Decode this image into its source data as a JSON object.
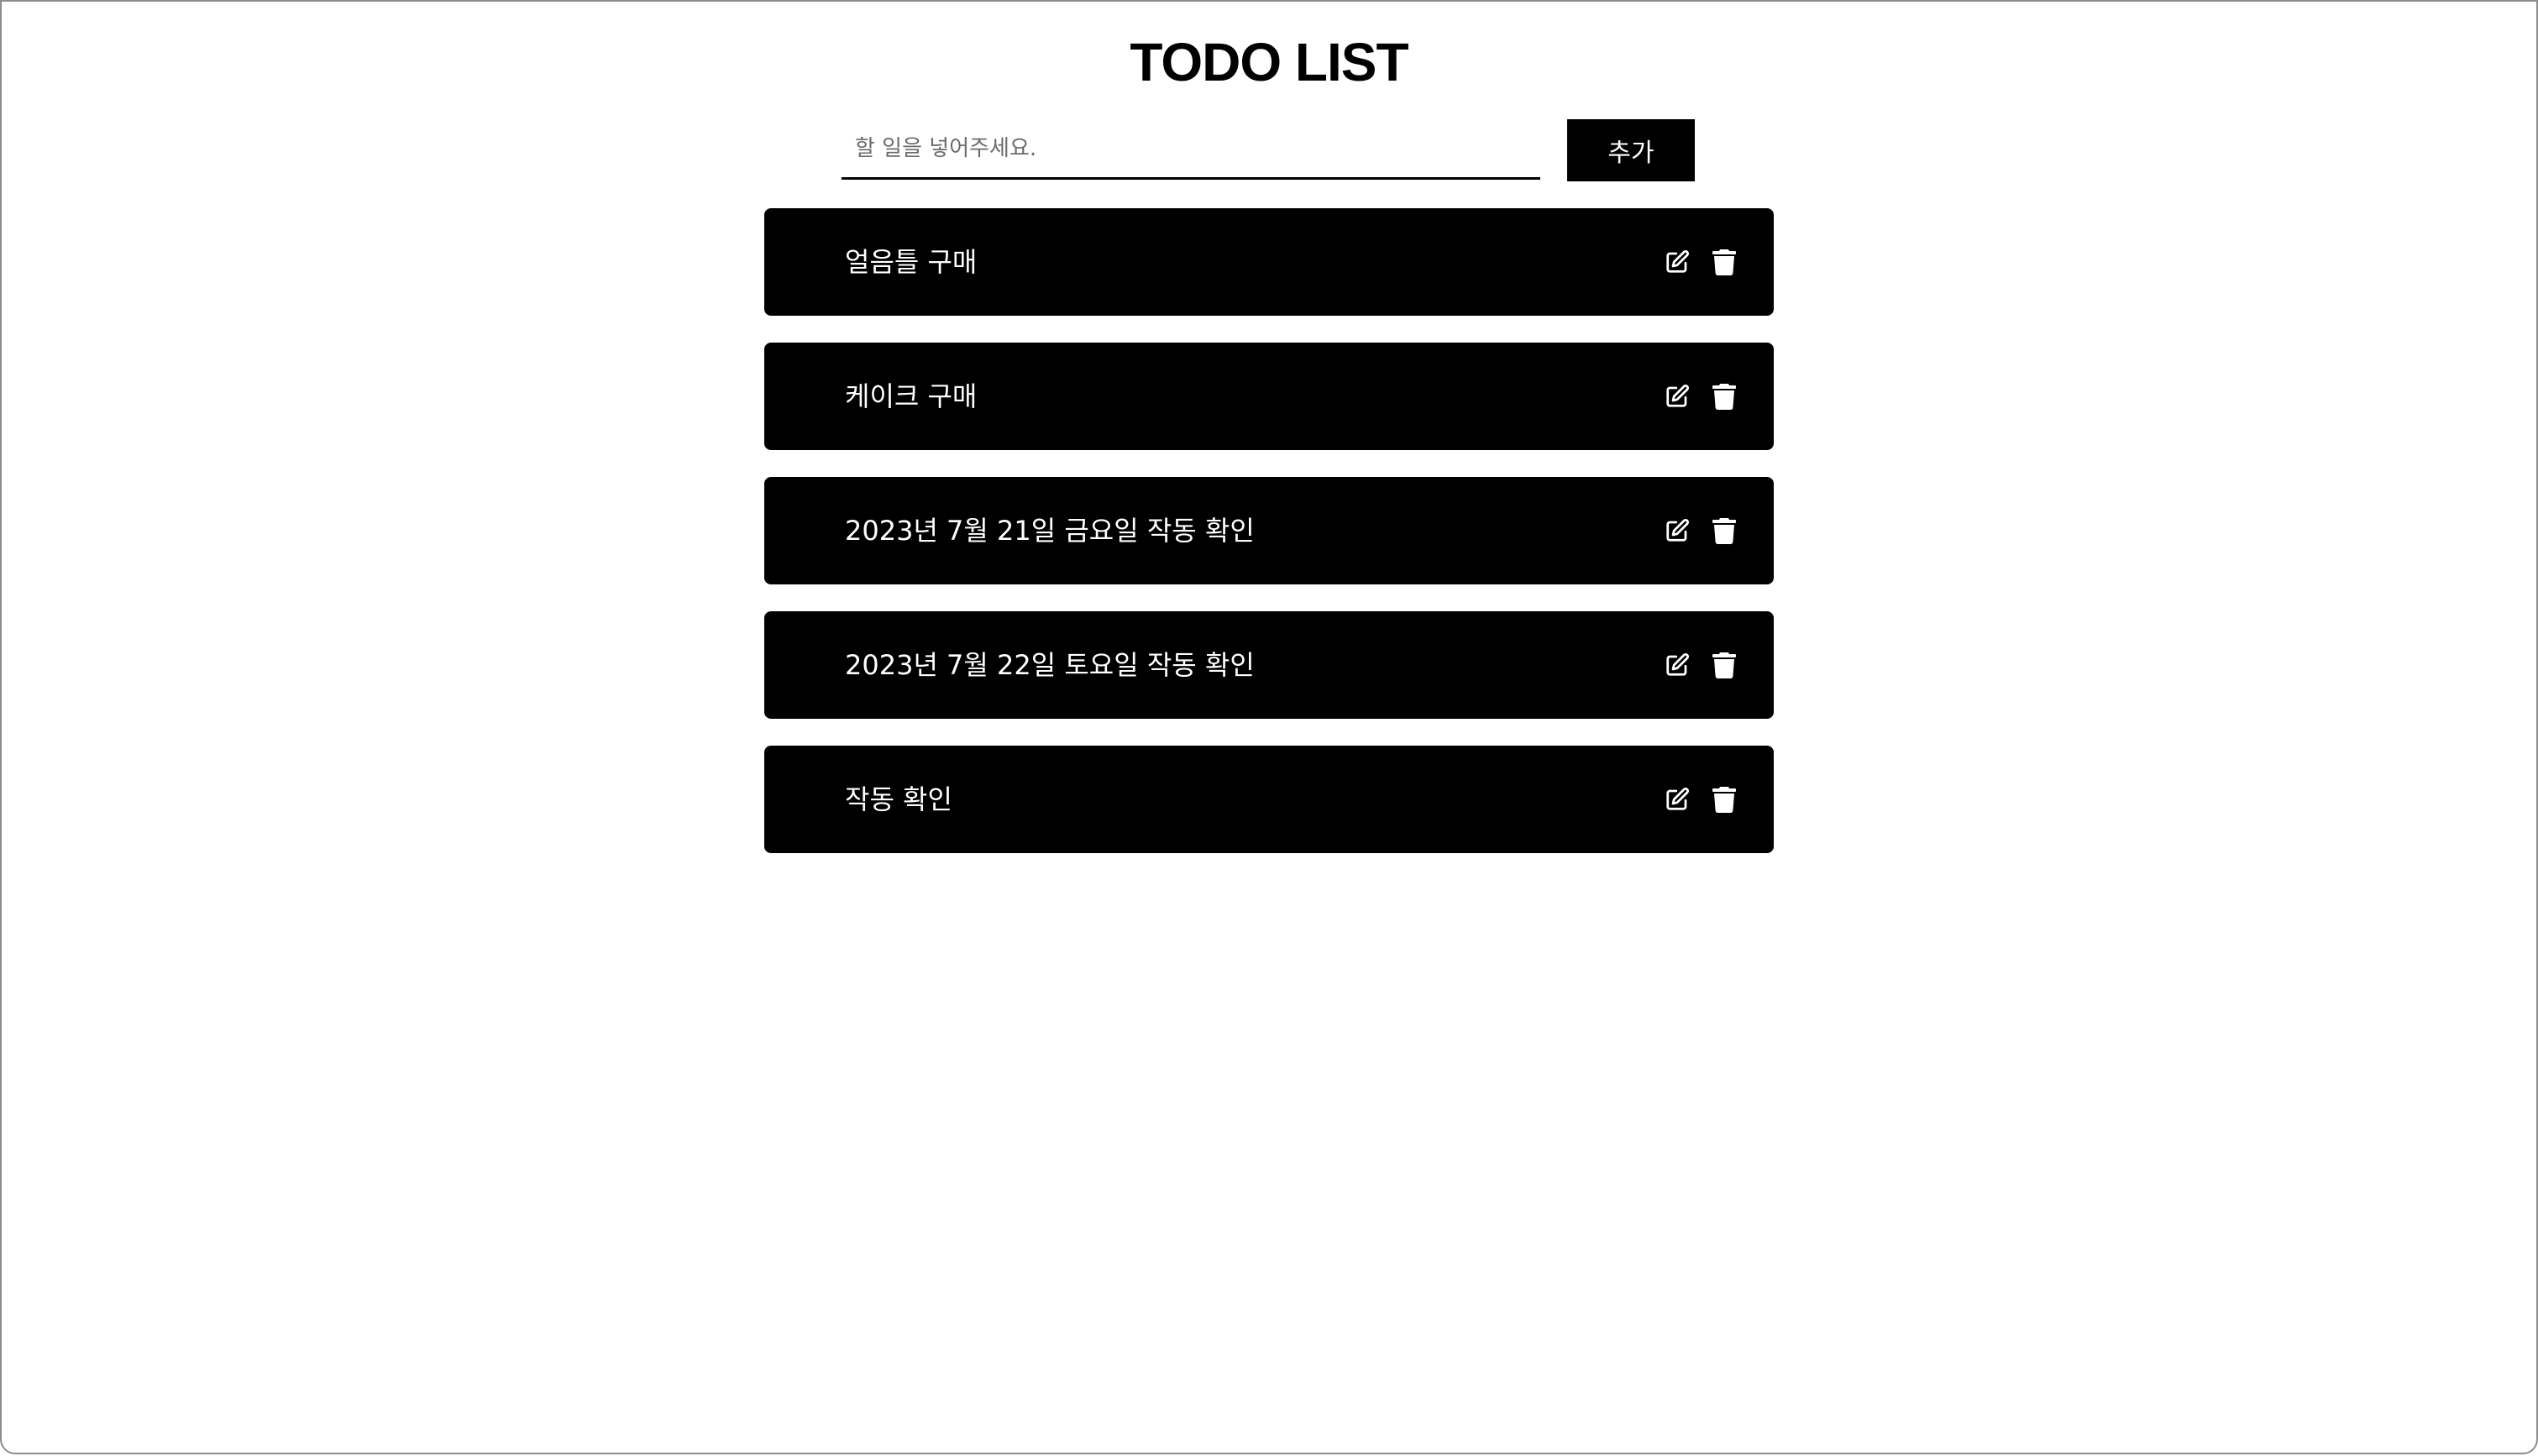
{
  "header": {
    "title": "TODO LIST"
  },
  "form": {
    "input_value": "",
    "input_placeholder": "할 일을 넣어주세요.",
    "add_label": "추가"
  },
  "todos": [
    {
      "text": "얼음틀 구매"
    },
    {
      "text": "케이크 구매"
    },
    {
      "text": "2023년 7월 21일 금요일 작동 확인"
    },
    {
      "text": "2023년 7월 22일 토요일 작동 확인"
    },
    {
      "text": "작동 확인"
    }
  ],
  "icons": {
    "edit": "edit-icon",
    "delete": "trash-icon"
  },
  "colors": {
    "background": "#ffffff",
    "item_background": "#000000",
    "item_text": "#ffffff",
    "button_background": "#000000"
  }
}
